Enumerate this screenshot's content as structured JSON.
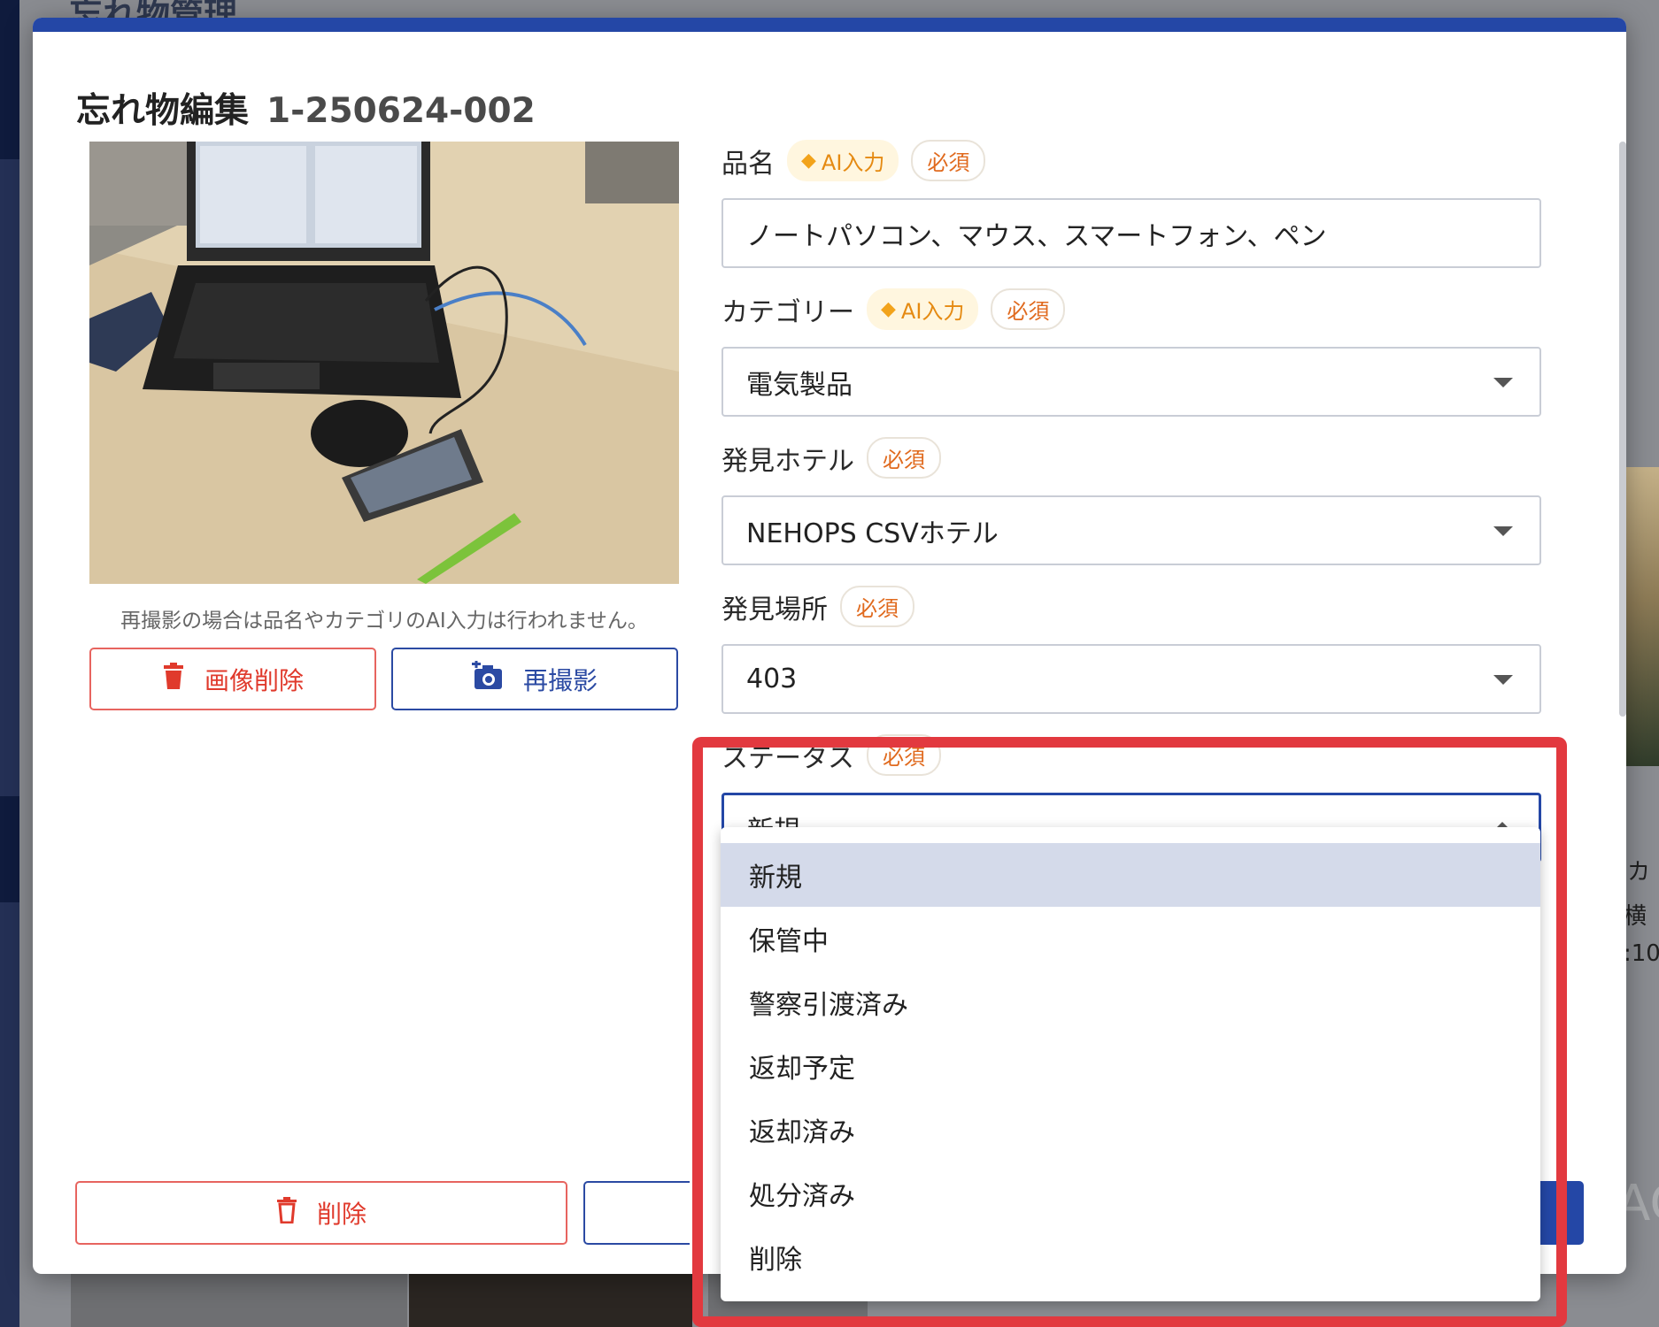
{
  "background": {
    "page_title": "忘れ物管理",
    "right_texts": [
      "カ",
      "横",
      ":10"
    ],
    "right_logo": "AG"
  },
  "modal": {
    "title": "忘れ物編集",
    "id": "1-250624-002",
    "photo_note": "再撮影の場合は品名やカテゴリのAI入力は行われません。",
    "delete_image_label": "画像削除",
    "retake_label": "再撮影",
    "delete_label": "削除"
  },
  "badges": {
    "ai": "AI入力",
    "required": "必須"
  },
  "fields": {
    "item_name": {
      "label": "品名",
      "value": "ノートパソコン、マウス、スマートフォン、ペン"
    },
    "category": {
      "label": "カテゴリー",
      "value": "電気製品"
    },
    "hotel": {
      "label": "発見ホテル",
      "value": "NEHOPS CSVホテル"
    },
    "location": {
      "label": "発見場所",
      "value": "403"
    },
    "status": {
      "label": "ステータス",
      "value": "新規"
    }
  },
  "status_options": [
    "新規",
    "保管中",
    "警察引渡済み",
    "返却予定",
    "返却済み",
    "処分済み",
    "削除"
  ],
  "status_selected_index": 0,
  "colors": {
    "accent": "#2447a6",
    "danger": "#e03a2c",
    "highlight": "#e2393f",
    "ai_badge": "#e58a12"
  }
}
